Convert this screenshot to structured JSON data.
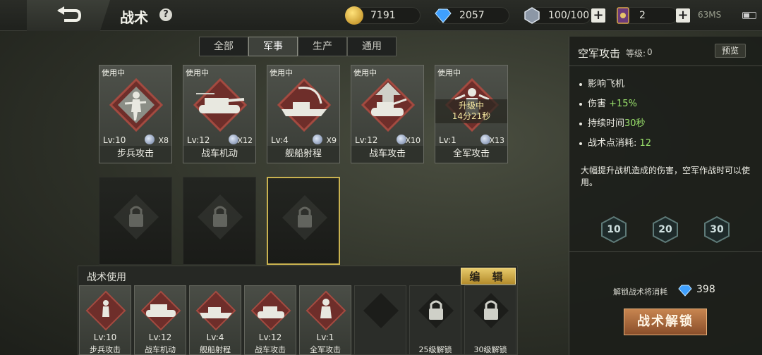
{
  "header": {
    "title": "战术",
    "help": "?",
    "resources": {
      "gold": "7191",
      "diamond": "2057",
      "energy": "100/100",
      "cards": "2"
    },
    "network": "63MS"
  },
  "tabs": [
    {
      "label": "全部"
    },
    {
      "label": "军事"
    },
    {
      "label": "生产"
    },
    {
      "label": "通用"
    }
  ],
  "cards": [
    {
      "status": "使用中",
      "lv": "Lv:10",
      "count": "X8",
      "name": "步兵攻击"
    },
    {
      "status": "使用中",
      "lv": "Lv:12",
      "count": "X12",
      "name": "战车机动"
    },
    {
      "status": "使用中",
      "lv": "Lv:4",
      "count": "X9",
      "name": "舰船射程"
    },
    {
      "status": "使用中",
      "lv": "Lv:12",
      "count": "X10",
      "name": "战车攻击"
    },
    {
      "status": "使用中",
      "lv": "Lv:1",
      "count": "X13",
      "name": "全军攻击",
      "upgrading": "升级中",
      "timer": "14分21秒"
    }
  ],
  "usebar": {
    "title": "战术使用",
    "edit": "编 辑",
    "slots": [
      {
        "lv": "Lv:10",
        "name": "步兵攻击"
      },
      {
        "lv": "Lv:12",
        "name": "战车机动"
      },
      {
        "lv": "Lv:4",
        "name": "舰船射程"
      },
      {
        "lv": "Lv:12",
        "name": "战车攻击"
      },
      {
        "lv": "Lv:1",
        "name": "全军攻击"
      },
      {
        "lv": "",
        "name": ""
      },
      {
        "lv": "",
        "name": "25级解锁"
      },
      {
        "lv": "",
        "name": "30级解锁"
      }
    ]
  },
  "panel": {
    "title": "空军攻击",
    "level_label": "等级:",
    "level": "0",
    "preview": "预览",
    "stats": [
      {
        "text": "影响飞机",
        "value": ""
      },
      {
        "text": "伤害 ",
        "value": "+15%"
      },
      {
        "text": "持续时间",
        "value": "30秒"
      },
      {
        "text": "战术点消耗: ",
        "value": "12"
      }
    ],
    "description": "大幅提升战机造成的伤害，空军作战时可以使用。",
    "levels": [
      "10",
      "20",
      "30"
    ],
    "cost_label": "解锁战术将消耗",
    "cost": "398",
    "unlock": "战术解锁"
  }
}
